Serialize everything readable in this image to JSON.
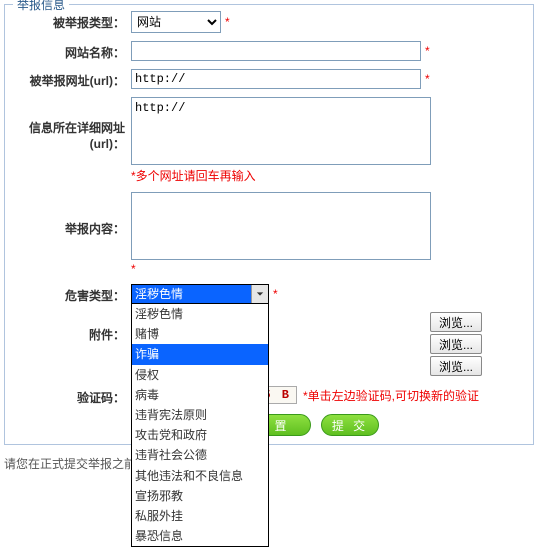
{
  "fieldset_title": "举报信息",
  "labels": {
    "report_type": "被举报类型：",
    "site_name": "网站名称：",
    "target_url": "被举报网址(url)：",
    "detail_url_l1": "信息所在详细网址",
    "detail_url_l2": "(url)：",
    "content": "举报内容：",
    "harm_type": "危害类型：",
    "attachment": "附件：",
    "captcha": "验证码："
  },
  "report_type_value": "网站",
  "url_value": "http://",
  "detail_url_value": "http://",
  "multi_url_hint": "*多个网址请回车再输入",
  "content_req": "*",
  "harm_selected": "淫秽色情",
  "harm_options": [
    "淫秽色情",
    "赌博",
    "诈骗",
    "侵权",
    "病毒",
    "违背宪法原则",
    "攻击党和政府",
    "违背社会公德",
    "其他违法和不良信息",
    "宣扬邪教",
    "私服外挂",
    "暴恐信息"
  ],
  "harm_highlight_index": 2,
  "browse_label": "浏览...",
  "captcha_text": "E 5 B",
  "captcha_hint": "*单击左边验证码,可切换新的验证",
  "btn_reset": "置",
  "btn_submit": "提 交",
  "footer_text": "请您在正式提交举报之前"
}
